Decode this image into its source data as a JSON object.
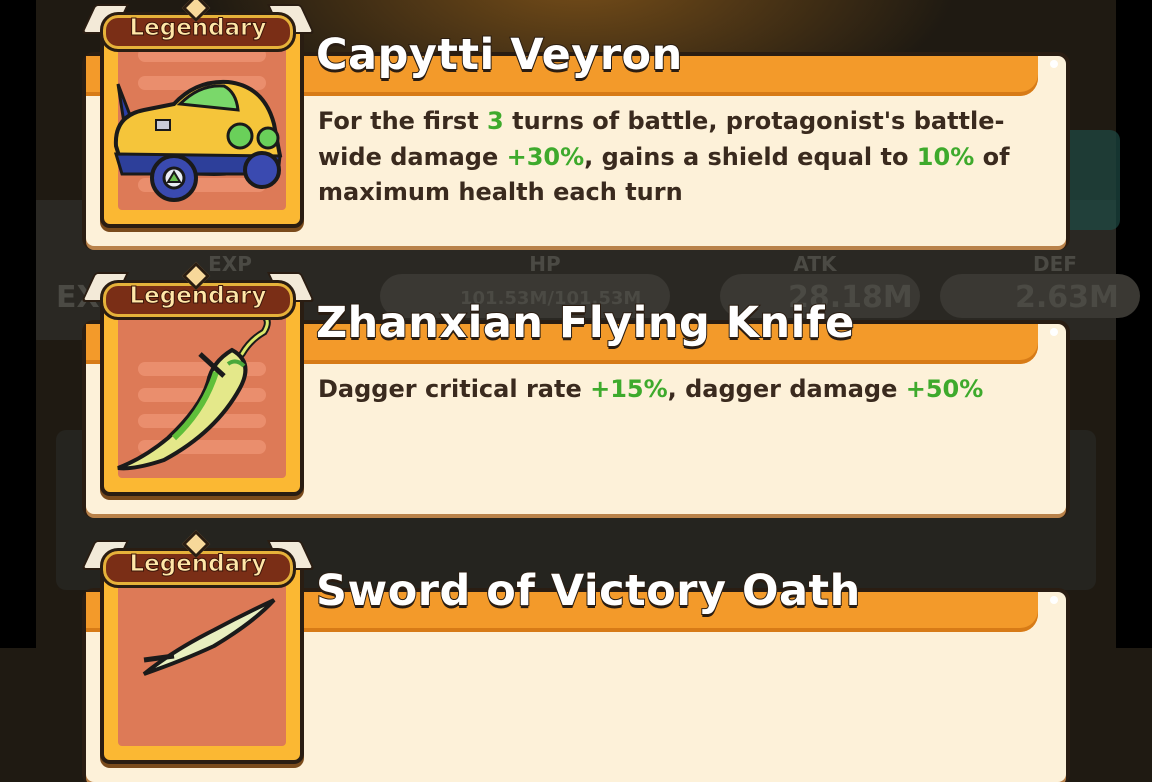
{
  "background": {
    "stats": [
      {
        "label": "EXP",
        "value": "EX"
      },
      {
        "label": "HP",
        "value": "101.53M/101.53M"
      },
      {
        "label": "ATK",
        "value": "28.18M"
      },
      {
        "label": "DEF",
        "value": "2.63M"
      }
    ]
  },
  "cards": [
    {
      "rarity": "Legendary",
      "name": "Capytti Veyron",
      "icon": "sports-car-icon",
      "desc": [
        {
          "t": "For the first "
        },
        {
          "t": "3",
          "g": true
        },
        {
          "t": " turns of battle, protagonist's battle-wide damage "
        },
        {
          "t": "+30%",
          "g": true
        },
        {
          "t": ", gains a shield equal to "
        },
        {
          "t": "10%",
          "g": true
        },
        {
          "t": " of maximum health each turn"
        }
      ]
    },
    {
      "rarity": "Legendary",
      "name": "Zhanxian Flying Knife",
      "icon": "flying-knife-icon",
      "desc": [
        {
          "t": "Dagger critical rate "
        },
        {
          "t": "+15%",
          "g": true
        },
        {
          "t": ", dagger damage "
        },
        {
          "t": "+50%",
          "g": true
        }
      ]
    },
    {
      "rarity": "Legendary",
      "name": "Sword of Victory Oath",
      "icon": "sword-icon",
      "desc": []
    }
  ],
  "colors": {
    "highlight": "#3eaa2c",
    "title_bar": "#f39a2a",
    "card_bg": "#fdf1d9",
    "frame": "#fbb833",
    "badge": "#7a2e16"
  }
}
